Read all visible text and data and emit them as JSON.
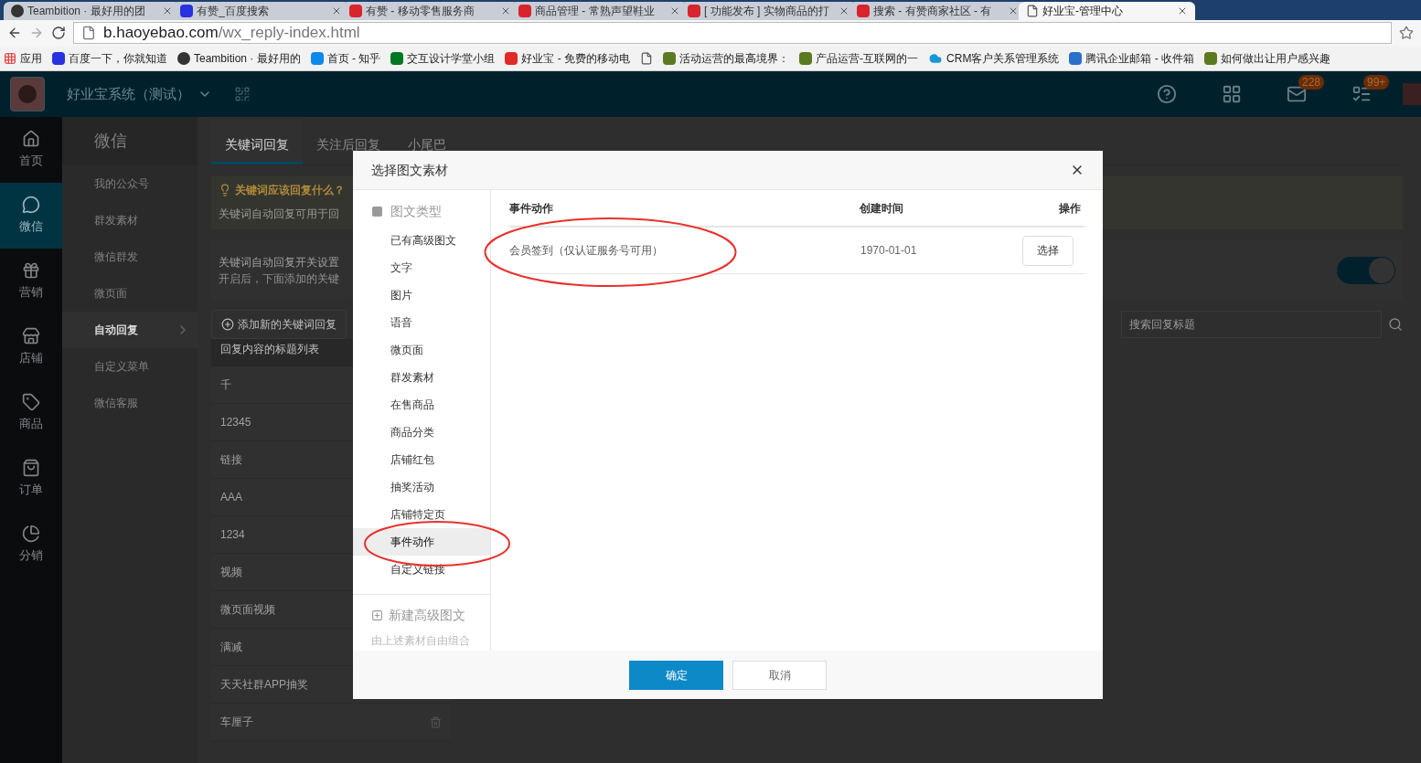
{
  "browser": {
    "tabs": [
      {
        "title": "Teambition · 最好用的团",
        "kind": "round",
        "selected": false
      },
      {
        "title": "有赞_百度搜索",
        "kind": "paw",
        "selected": false
      },
      {
        "title": "有赞 - 移动零售服务商",
        "kind": "thumb",
        "selected": false
      },
      {
        "title": "商品管理 - 常熟声望鞋业",
        "kind": "thumb",
        "selected": false
      },
      {
        "title": "[ 功能发布 ] 实物商品的打",
        "kind": "thumb",
        "selected": false
      },
      {
        "title": "搜索 - 有赞商家社区 - 有",
        "kind": "thumb",
        "selected": false
      },
      {
        "title": "好业宝-管理中心",
        "kind": "page",
        "selected": true
      }
    ],
    "url_host": "b.haoyebao.com",
    "url_path": "/wx_reply-index.html",
    "bookmarks": [
      {
        "label": "应用",
        "kind": "apps"
      },
      {
        "label": "百度一下，你就知道",
        "kind": "paw"
      },
      {
        "label": "Teambition · 最好用的",
        "kind": "round"
      },
      {
        "label": "首页 - 知乎",
        "kind": "blue"
      },
      {
        "label": "交互设计学堂小组",
        "kind": "green"
      },
      {
        "label": "好业宝 - 免费的移动电",
        "kind": "red"
      },
      {
        "kind": "page"
      },
      {
        "label": "活动运营的最高境界：",
        "kind": "olive"
      },
      {
        "label": "产品运营-互联网的一",
        "kind": "olive"
      },
      {
        "label": "CRM客户关系管理系统",
        "kind": "cloud"
      },
      {
        "label": "腾讯企业邮箱 - 收件箱",
        "kind": "mail"
      },
      {
        "label": "如何做出让用户感兴趣",
        "kind": "olive"
      }
    ]
  },
  "header": {
    "brand": "好业宝系统（测试）",
    "badges": [
      {
        "kind": "help"
      },
      {
        "kind": "apps"
      },
      {
        "kind": "mail",
        "count": "228"
      },
      {
        "kind": "tasks",
        "count": "99+"
      }
    ]
  },
  "nav_rail": [
    {
      "label": "首页",
      "kind": "home",
      "selected": false
    },
    {
      "label": "微信",
      "kind": "chat",
      "selected": true
    },
    {
      "label": "营销",
      "kind": "gift",
      "selected": false
    },
    {
      "label": "店铺",
      "kind": "store",
      "selected": false
    },
    {
      "label": "商品",
      "kind": "tag",
      "selected": false
    },
    {
      "label": "订单",
      "kind": "bag",
      "selected": false
    },
    {
      "label": "分销",
      "kind": "pie",
      "selected": false
    }
  ],
  "submenu": {
    "title": "微信",
    "items": [
      {
        "label": "我的公众号",
        "selected": false
      },
      {
        "label": "群发素材",
        "selected": false
      },
      {
        "label": "微信群发",
        "selected": false
      },
      {
        "label": "微页面",
        "selected": false
      },
      {
        "label": "自动回复",
        "selected": true
      },
      {
        "label": "自定义菜单",
        "selected": false
      },
      {
        "label": "微信客服",
        "selected": false
      }
    ]
  },
  "content": {
    "tabs": [
      {
        "label": "关键词回复",
        "selected": true
      },
      {
        "label": "关注后回复",
        "selected": false
      },
      {
        "label": "小尾巴",
        "selected": false
      }
    ],
    "tip": {
      "title": "关键词应该回复什么？",
      "text": "关键词自动回复可用于回"
    },
    "setting": {
      "title": "关键词自动回复开关设置",
      "text": "开启后，下面添加的关键",
      "on": true
    },
    "add_button": "添加新的关键词回复",
    "search": {
      "placeholder": "搜索回复标题"
    },
    "list_header": "回复内容的标题列表",
    "rows": [
      "千",
      "12345",
      "链接",
      "AAA",
      "1234",
      "视频",
      "微页面视频",
      "满减",
      "天天社群APP抽奖",
      "车厘子"
    ]
  },
  "modal": {
    "title": "选择图文素材",
    "category_heading": "图文类型",
    "categories": [
      {
        "label": "已有高级图文",
        "selected": false
      },
      {
        "label": "文字",
        "selected": false
      },
      {
        "label": "图片",
        "selected": false
      },
      {
        "label": "语音",
        "selected": false
      },
      {
        "label": "微页面",
        "selected": false
      },
      {
        "label": "群发素材",
        "selected": false
      },
      {
        "label": "在售商品",
        "selected": false
      },
      {
        "label": "商品分类",
        "selected": false
      },
      {
        "label": "店铺红包",
        "selected": false
      },
      {
        "label": "抽奖活动",
        "selected": false
      },
      {
        "label": "店铺特定页",
        "selected": false
      },
      {
        "label": "事件动作",
        "selected": true
      },
      {
        "label": "自定义链接",
        "selected": false
      }
    ],
    "new_item": {
      "label": "新建高级图文",
      "hint": "由上述素材自由组合"
    },
    "table": {
      "columns": [
        "事件动作",
        "创建时间",
        "操作"
      ],
      "rows": [
        {
          "name": "会员签到（仅认证服务号可用）",
          "created": "1970-01-01",
          "action": "选择"
        }
      ]
    },
    "buttons": [
      {
        "label": "确定",
        "kind": "primary"
      },
      {
        "label": "取消",
        "kind": "secondary"
      }
    ]
  }
}
